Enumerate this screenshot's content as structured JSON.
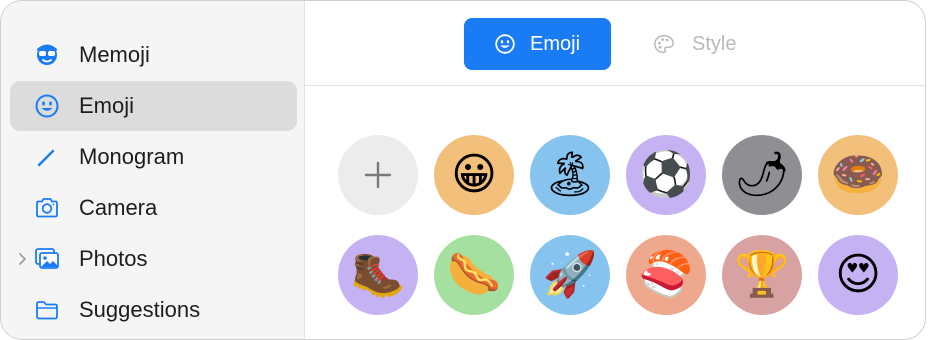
{
  "sidebar": {
    "items": [
      {
        "label": "Memoji",
        "icon": "memoji-icon"
      },
      {
        "label": "Emoji",
        "icon": "smiley-icon",
        "selected": true
      },
      {
        "label": "Monogram",
        "icon": "pencil-icon"
      },
      {
        "label": "Camera",
        "icon": "camera-icon"
      },
      {
        "label": "Photos",
        "icon": "photos-icon",
        "expandable": true
      },
      {
        "label": "Suggestions",
        "icon": "folder-icon"
      }
    ]
  },
  "tabs": [
    {
      "label": "Emoji",
      "icon": "smiley-icon",
      "active": true
    },
    {
      "label": "Style",
      "icon": "palette-icon",
      "active": false
    }
  ],
  "emoji_grid": {
    "add_icon": "plus-icon",
    "rows": [
      [
        {
          "glyph": "😀",
          "name": "grinning-face",
          "bg": "#f2c07a"
        },
        {
          "glyph": "🏝",
          "name": "beach-umbrella",
          "bg": "#86c3ee"
        },
        {
          "glyph": "⚽",
          "name": "soccer-ball",
          "bg": "#c5b2f2"
        },
        {
          "glyph": "🌶",
          "name": "hot-pepper",
          "bg": "#8e8e93"
        },
        {
          "glyph": "🍩",
          "name": "doughnut",
          "bg": "#f2c07a"
        }
      ],
      [
        {
          "glyph": "🥾",
          "name": "hiking-boot",
          "bg": "#c5b2f2"
        },
        {
          "glyph": "🌭",
          "name": "hot-dog",
          "bg": "#a6e0a0"
        },
        {
          "glyph": "🚀",
          "name": "rocket",
          "bg": "#86c3ee"
        },
        {
          "glyph": "🍣",
          "name": "sushi",
          "bg": "#eea88e"
        },
        {
          "glyph": "🏆",
          "name": "trophy",
          "bg": "#d9a2a2"
        },
        {
          "glyph": "😍",
          "name": "heart-eyes",
          "bg": "#c5b2f2"
        }
      ]
    ]
  },
  "colors": {
    "accent": "#1a7cf5",
    "sidebar_bg": "#f6f5f6",
    "selected_bg": "#dcdcdc"
  }
}
